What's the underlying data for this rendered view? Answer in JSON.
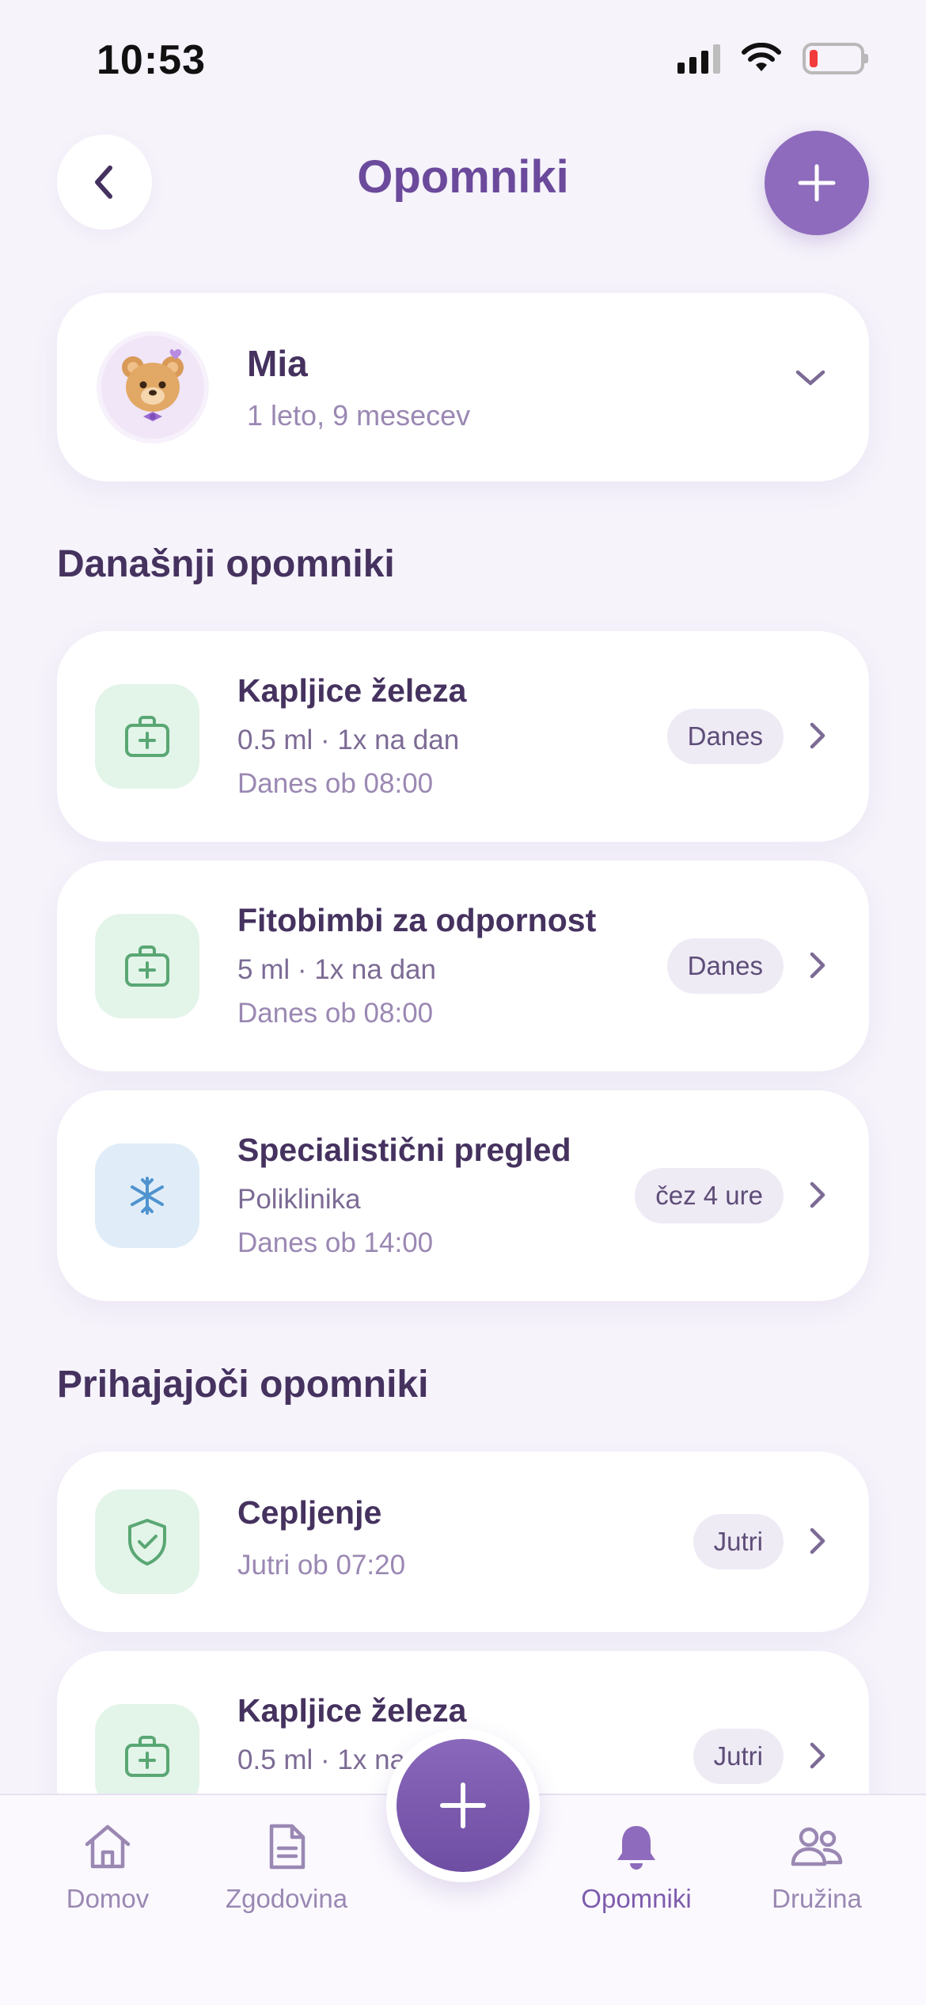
{
  "status_bar": {
    "time": "10:53"
  },
  "header": {
    "title": "Opomniki"
  },
  "child": {
    "name": "Mia",
    "age": "1 leto, 9 mesecev"
  },
  "sections": {
    "today_title": "Današnji opomniki",
    "upcoming_title": "Prihajajoči opomniki"
  },
  "today": [
    {
      "title": "Kapljice železa",
      "detail": "0.5 ml · 1x na dan",
      "time": "Danes ob 08:00",
      "badge": "Danes",
      "icon": "medicine-kit-icon"
    },
    {
      "title": "Fitobimbi za odpornost",
      "detail": "5 ml · 1x na dan",
      "time": "Danes ob 08:00",
      "badge": "Danes",
      "icon": "medicine-kit-icon"
    },
    {
      "title": "Specialistični pregled",
      "detail": "Poliklinika",
      "time": "Danes ob 14:00",
      "badge": "čez 4 ure",
      "icon": "medical-star-icon"
    }
  ],
  "upcoming": [
    {
      "title": "Cepljenje",
      "time": "Jutri ob 07:20",
      "badge": "Jutri",
      "icon": "shield-check-icon"
    },
    {
      "title": "Kapljice železa",
      "detail": "0.5 ml · 1x na",
      "badge": "Jutri",
      "icon": "medicine-kit-icon"
    }
  ],
  "nav": [
    {
      "label": "Domov",
      "icon": "home-icon"
    },
    {
      "label": "Zgodovina",
      "icon": "document-icon"
    },
    {
      "label": "Opomniki",
      "icon": "bell-icon",
      "active": true
    },
    {
      "label": "Družina",
      "icon": "family-icon"
    }
  ],
  "colors": {
    "accent": "#8e6bbc",
    "background": "#f6f3fb",
    "green_tile": "#e3f4e9",
    "blue_tile": "#e0edf8",
    "green_icon": "#5aa774",
    "blue_icon": "#4f93cf"
  }
}
